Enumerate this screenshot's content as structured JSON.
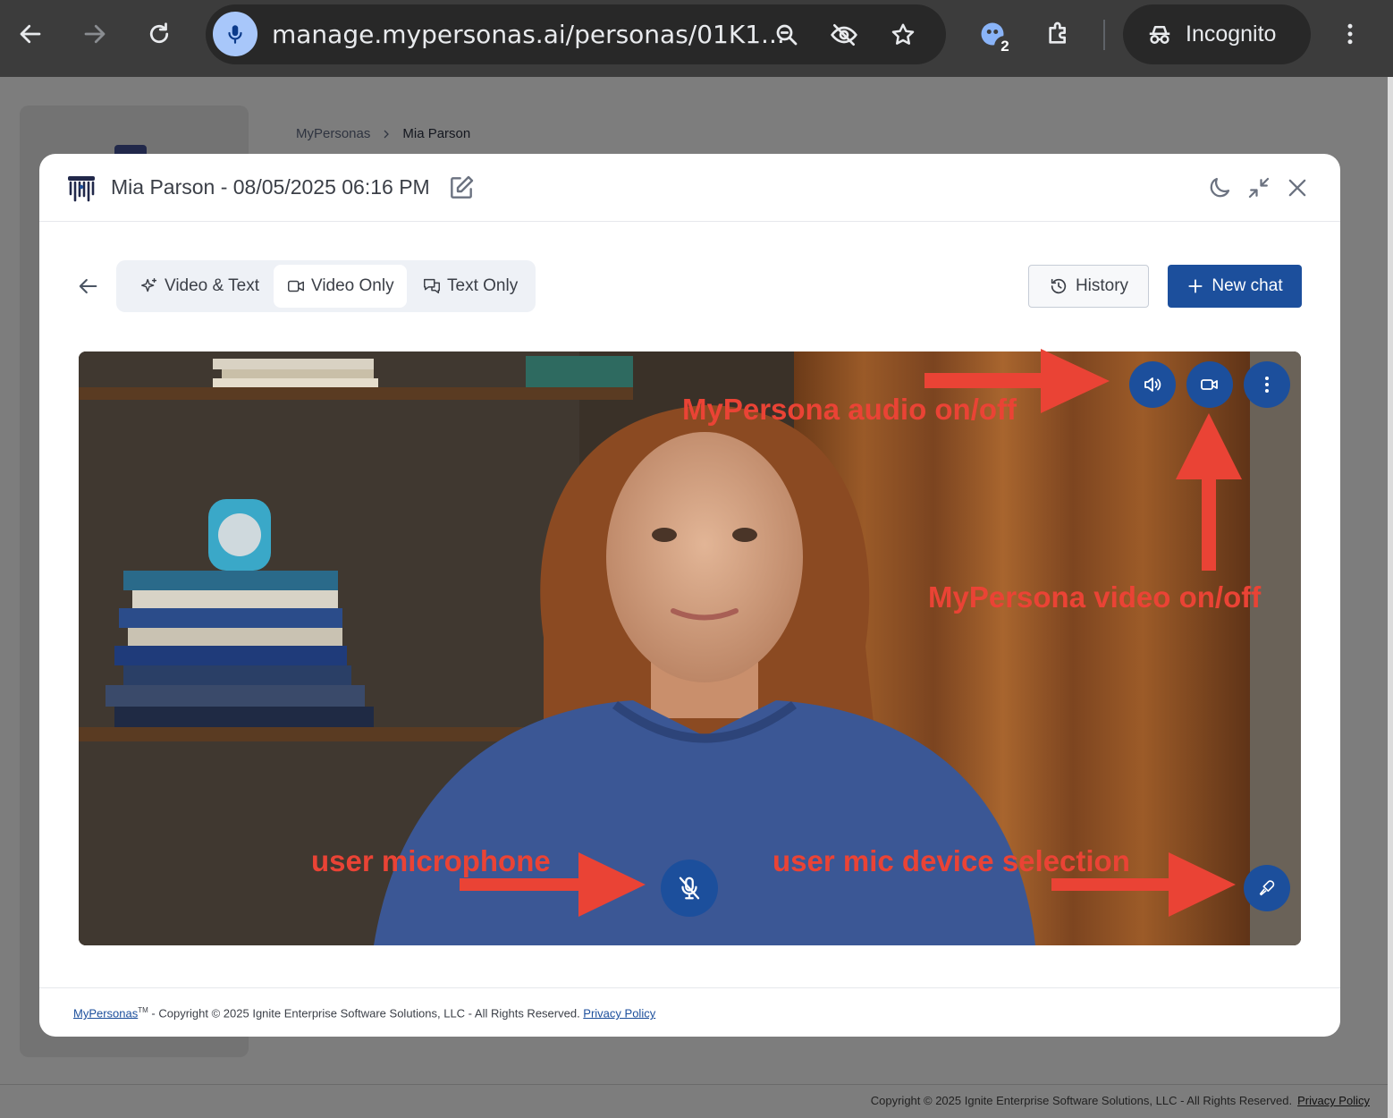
{
  "browser": {
    "url": "manage.mypersonas.ai/personas/01K1...",
    "extension_badge": "2",
    "incognito_label": "Incognito"
  },
  "background_page": {
    "breadcrumb": {
      "root": "MyPersonas",
      "current": "Mia Parson"
    },
    "footer": {
      "copyright": "Copyright © 2025 Ignite Enterprise Software Solutions, LLC - All Rights Reserved.",
      "privacy": "Privacy Policy"
    }
  },
  "modal": {
    "title": "Mia Parson - 08/05/2025 06:16 PM",
    "modes": [
      {
        "label": "Video & Text",
        "icon": "sparkles-icon"
      },
      {
        "label": "Video Only",
        "icon": "video-icon",
        "active": true
      },
      {
        "label": "Text Only",
        "icon": "chat-icon"
      }
    ],
    "history_label": "History",
    "new_chat_label": "New chat",
    "footer": {
      "brand": "MyPersonas",
      "tm": "TM",
      "copyright": " - Copyright © 2025 Ignite Enterprise Software Solutions, LLC - All Rights Reserved. ",
      "privacy": "Privacy Policy"
    }
  },
  "annotations": {
    "audio": "MyPersona audio on/off",
    "video": "MyPersona video on/off",
    "microphone": "user microphone",
    "mic_device": "user mic device selection"
  },
  "colors": {
    "primary": "#1c4f9c",
    "annotation": "#ea4335"
  }
}
